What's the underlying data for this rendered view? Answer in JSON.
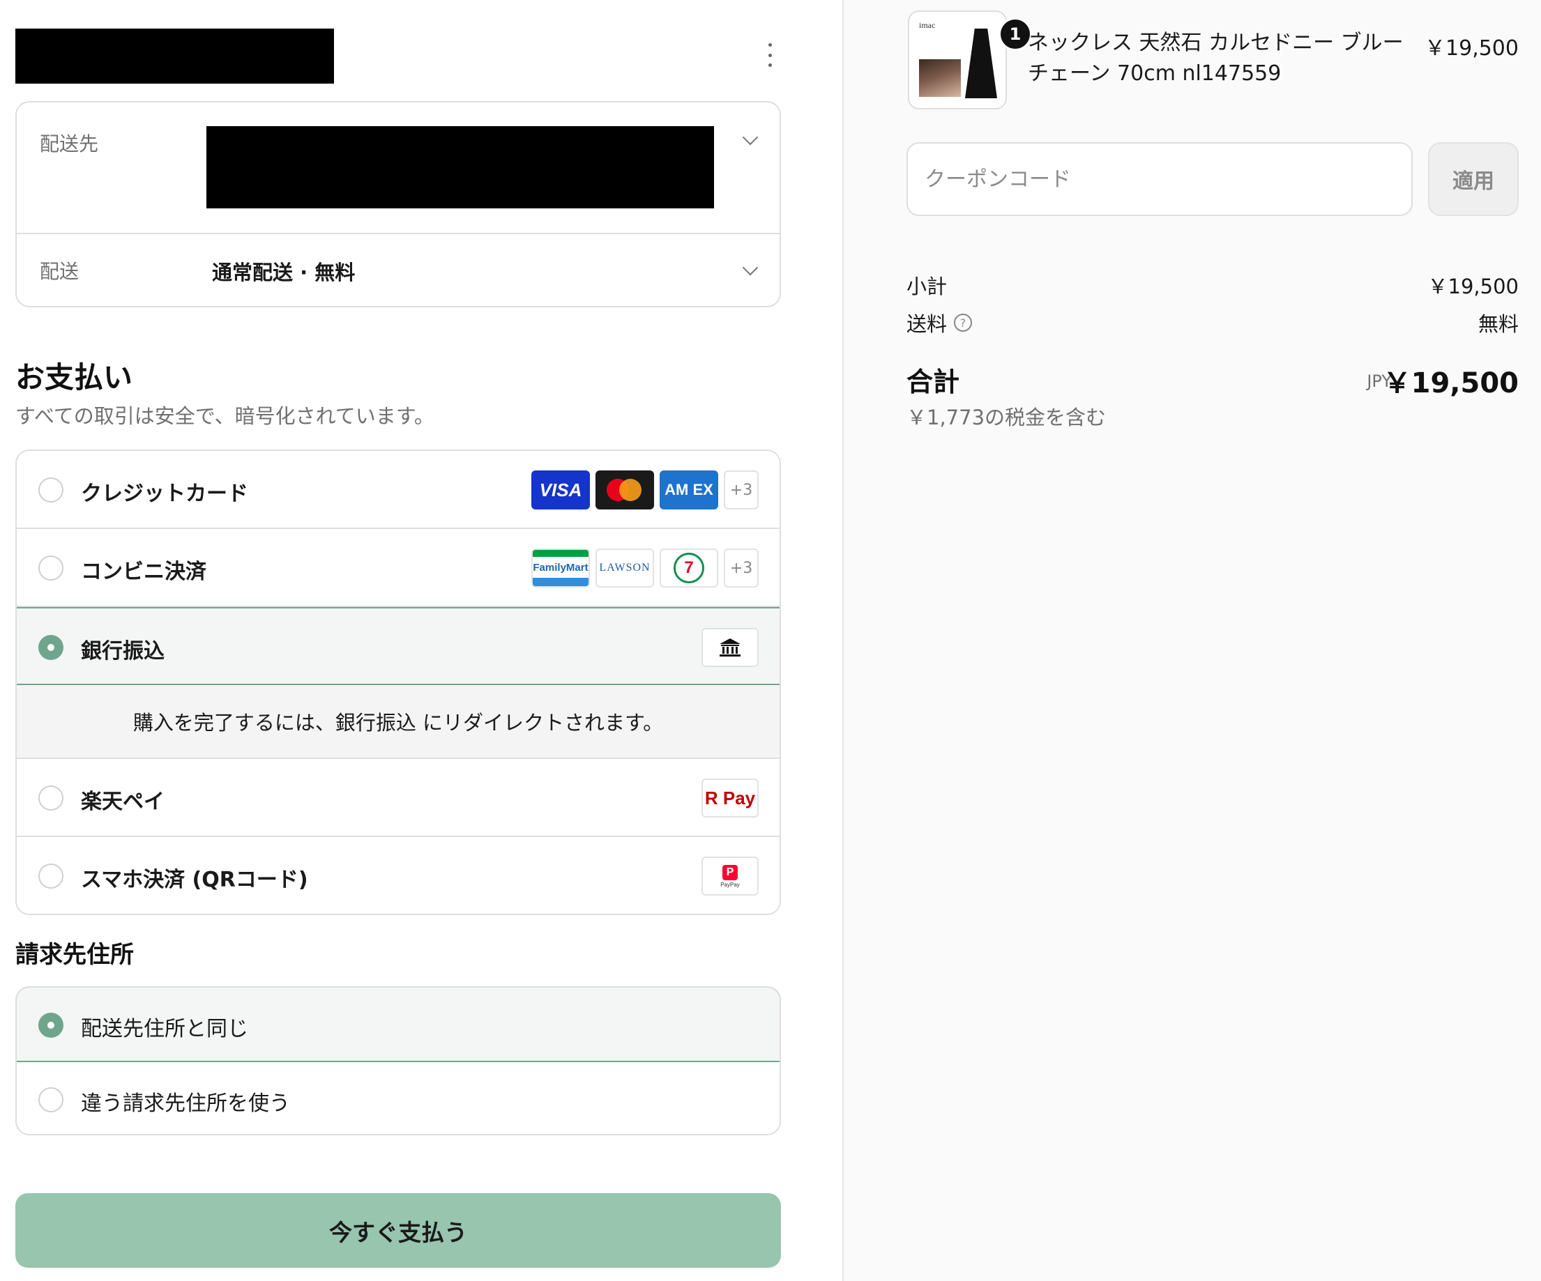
{
  "shipping": {
    "address_label": "配送先",
    "method_label": "配送",
    "method_value": "通常配送 · 無料"
  },
  "payment": {
    "title": "お支払い",
    "subtitle": "すべての取引は安全で、暗号化されています。",
    "options": [
      {
        "label": "クレジットカード",
        "selected": false,
        "badges": [
          "VISA",
          "mastercard",
          "AM EX",
          "+3"
        ]
      },
      {
        "label": "コンビニ決済",
        "selected": false,
        "badges": [
          "FamilyMart",
          "LAWSON",
          "7-Eleven",
          "+3"
        ]
      },
      {
        "label": "銀行振込",
        "selected": true,
        "badges": [
          "bank-icon"
        ]
      },
      {
        "label": "楽天ペイ",
        "selected": false,
        "badges": [
          "R Pay"
        ]
      },
      {
        "label": "スマホ決済 (QRコード)",
        "selected": false,
        "badges": [
          "PayPay"
        ]
      }
    ],
    "bank_info": "購入を完了するには、銀行振込 にリダイレクトされます。",
    "badge_text": {
      "visa": "VISA",
      "amex": "AM EX",
      "more": "+3",
      "familymart": "FamilyMart",
      "lawson": "LAWSON",
      "seven": "7",
      "rpay": "R Pay",
      "paypay": "PayPay"
    }
  },
  "billing": {
    "title": "請求先住所",
    "options": [
      {
        "label": "配送先住所と同じ",
        "selected": true
      },
      {
        "label": "違う請求先住所を使う",
        "selected": false
      }
    ]
  },
  "pay_button": "今すぐ支払う",
  "summary": {
    "product": {
      "name": "ネックレス 天然石 カルセドニー ブルー チェーン 70cm nl147559",
      "price": "￥19,500",
      "quantity": "1",
      "thumb_logo": "imac"
    },
    "coupon": {
      "placeholder": "クーポンコード",
      "apply": "適用"
    },
    "subtotal_label": "小計",
    "subtotal_value": "￥19,500",
    "shipping_label": "送料",
    "shipping_value": "無料",
    "total_label": "合計",
    "currency": "JPY",
    "total_value": "￥19,500",
    "tax_note": "￥1,773の税金を含む"
  },
  "colors": {
    "accent": "#6fa58d",
    "button": "#97c5ae",
    "selected_bg": "#f3f6f4"
  }
}
